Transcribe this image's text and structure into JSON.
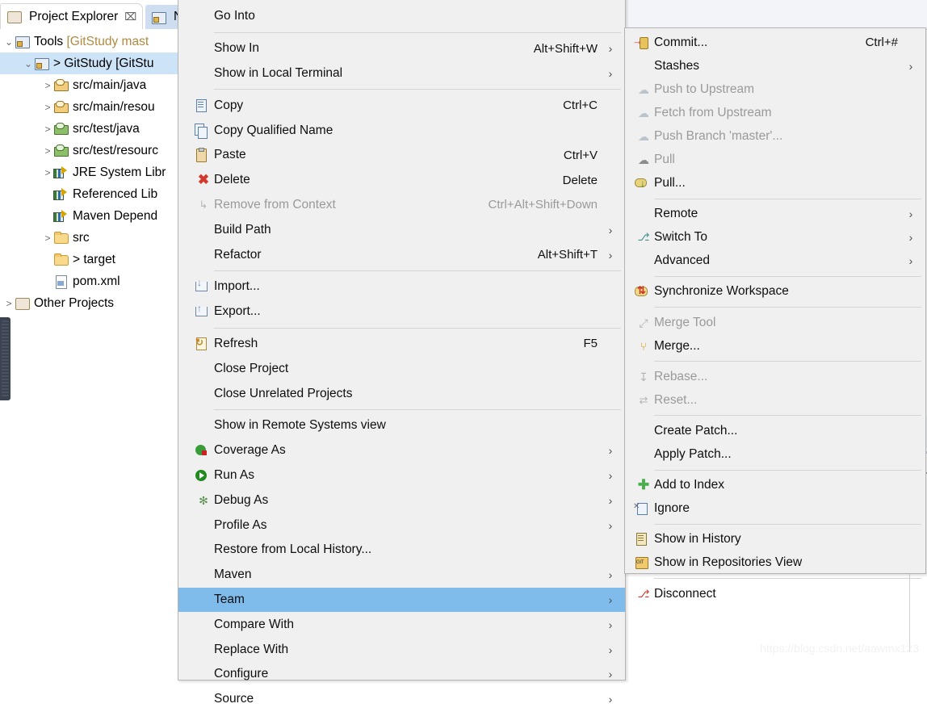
{
  "app": {
    "watermark": "https://blog.csdn.net/aawmx123"
  },
  "left_view": {
    "tabs": [
      {
        "label": "Project Explorer",
        "icon": "project-explorer-icon",
        "close": "⌧",
        "active": true
      },
      {
        "label": "Na",
        "icon": "navigator-icon",
        "active": false
      }
    ],
    "tree": [
      {
        "indent": 0,
        "twisty": "⌄",
        "icon": "project-icon",
        "label": "Tools ",
        "suffix": "[GitStudy mast",
        "selected": false
      },
      {
        "indent": 1,
        "twisty": "⌄",
        "icon": "maven-project-icon",
        "label": "> GitStudy [GitStu",
        "suffix": "",
        "selected": true
      },
      {
        "indent": 2,
        "twisty": ">",
        "icon": "source-package-icon",
        "label": "src/main/java",
        "suffix": "",
        "selected": false
      },
      {
        "indent": 2,
        "twisty": ">",
        "icon": "source-package-icon",
        "label": "src/main/resou",
        "suffix": "",
        "selected": false
      },
      {
        "indent": 2,
        "twisty": ">",
        "icon": "test-package-icon",
        "label": "src/test/java",
        "suffix": "",
        "selected": false
      },
      {
        "indent": 2,
        "twisty": ">",
        "icon": "test-package-icon",
        "label": "src/test/resourc",
        "suffix": "",
        "selected": false
      },
      {
        "indent": 2,
        "twisty": ">",
        "icon": "library-icon",
        "label": "JRE System Libr",
        "suffix": "",
        "selected": false
      },
      {
        "indent": 2,
        "twisty": "",
        "icon": "library-icon",
        "label": "Referenced Lib",
        "suffix": "",
        "selected": false
      },
      {
        "indent": 2,
        "twisty": "",
        "icon": "library-icon",
        "label": "Maven Depend",
        "suffix": "",
        "selected": false
      },
      {
        "indent": 2,
        "twisty": ">",
        "icon": "folder-icon",
        "label": "src",
        "suffix": "",
        "selected": false
      },
      {
        "indent": 2,
        "twisty": "",
        "icon": "folder-icon",
        "label": "> target",
        "suffix": "",
        "selected": false
      },
      {
        "indent": 2,
        "twisty": "",
        "icon": "xml-file-icon",
        "label": "pom.xml",
        "suffix": "",
        "selected": false
      },
      {
        "indent": 0,
        "twisty": ">",
        "icon": "other-projects-icon",
        "label": "Other Projects",
        "suffix": "",
        "selected": false
      }
    ]
  },
  "context_menu": {
    "name": "project-context-menu",
    "items": [
      {
        "type": "item",
        "icon": "",
        "label": "Go Into",
        "accel": "",
        "arrow": false,
        "disabled": false
      },
      {
        "type": "sep"
      },
      {
        "type": "item",
        "icon": "",
        "label": "Show In",
        "accel": "Alt+Shift+W",
        "arrow": true,
        "disabled": false
      },
      {
        "type": "item",
        "icon": "",
        "label": "Show in Local Terminal",
        "accel": "",
        "arrow": true,
        "disabled": false
      },
      {
        "type": "sep"
      },
      {
        "type": "item",
        "icon": "copy-icon",
        "label": "Copy",
        "accel": "Ctrl+C",
        "arrow": false,
        "disabled": false
      },
      {
        "type": "item",
        "icon": "copy-qualified-name-icon",
        "label": "Copy Qualified Name",
        "accel": "",
        "arrow": false,
        "disabled": false
      },
      {
        "type": "item",
        "icon": "paste-icon",
        "label": "Paste",
        "accel": "Ctrl+V",
        "arrow": false,
        "disabled": false
      },
      {
        "type": "item",
        "icon": "delete-icon",
        "label": "Delete",
        "accel": "Delete",
        "arrow": false,
        "disabled": false
      },
      {
        "type": "item",
        "icon": "remove-from-context-icon",
        "label": "Remove from Context",
        "accel": "Ctrl+Alt+Shift+Down",
        "arrow": false,
        "disabled": true
      },
      {
        "type": "item",
        "icon": "",
        "label": "Build Path",
        "accel": "",
        "arrow": true,
        "disabled": false
      },
      {
        "type": "item",
        "icon": "",
        "label": "Refactor",
        "accel": "Alt+Shift+T",
        "arrow": true,
        "disabled": false
      },
      {
        "type": "sep"
      },
      {
        "type": "item",
        "icon": "import-icon",
        "label": "Import...",
        "accel": "",
        "arrow": false,
        "disabled": false
      },
      {
        "type": "item",
        "icon": "export-icon",
        "label": "Export...",
        "accel": "",
        "arrow": false,
        "disabled": false
      },
      {
        "type": "sep"
      },
      {
        "type": "item",
        "icon": "refresh-icon",
        "label": "Refresh",
        "accel": "F5",
        "arrow": false,
        "disabled": false
      },
      {
        "type": "item",
        "icon": "",
        "label": "Close Project",
        "accel": "",
        "arrow": false,
        "disabled": false
      },
      {
        "type": "item",
        "icon": "",
        "label": "Close Unrelated Projects",
        "accel": "",
        "arrow": false,
        "disabled": false
      },
      {
        "type": "sep"
      },
      {
        "type": "item",
        "icon": "",
        "label": "Show in Remote Systems view",
        "accel": "",
        "arrow": false,
        "disabled": false
      },
      {
        "type": "item",
        "icon": "coverage-icon",
        "label": "Coverage As",
        "accel": "",
        "arrow": true,
        "disabled": false
      },
      {
        "type": "item",
        "icon": "run-icon",
        "label": "Run As",
        "accel": "",
        "arrow": true,
        "disabled": false
      },
      {
        "type": "item",
        "icon": "debug-icon",
        "label": "Debug As",
        "accel": "",
        "arrow": true,
        "disabled": false
      },
      {
        "type": "item",
        "icon": "",
        "label": "Profile As",
        "accel": "",
        "arrow": true,
        "disabled": false
      },
      {
        "type": "item",
        "icon": "",
        "label": "Restore from Local History...",
        "accel": "",
        "arrow": false,
        "disabled": false
      },
      {
        "type": "item",
        "icon": "",
        "label": "Maven",
        "accel": "",
        "arrow": true,
        "disabled": false
      },
      {
        "type": "item",
        "icon": "",
        "label": "Team",
        "accel": "",
        "arrow": true,
        "disabled": false,
        "selected": true
      },
      {
        "type": "item",
        "icon": "",
        "label": "Compare With",
        "accel": "",
        "arrow": true,
        "disabled": false
      },
      {
        "type": "item",
        "icon": "",
        "label": "Replace With",
        "accel": "",
        "arrow": true,
        "disabled": false
      },
      {
        "type": "item",
        "icon": "",
        "label": "Configure",
        "accel": "",
        "arrow": true,
        "disabled": false
      },
      {
        "type": "item",
        "icon": "",
        "label": "Source",
        "accel": "",
        "arrow": true,
        "disabled": false
      }
    ]
  },
  "team_submenu": {
    "name": "team-submenu",
    "items": [
      {
        "type": "item",
        "icon": "commit-icon",
        "label": "Commit...",
        "accel": "Ctrl+#",
        "arrow": false,
        "disabled": false
      },
      {
        "type": "item",
        "icon": "",
        "label": "Stashes",
        "accel": "",
        "arrow": true,
        "disabled": false
      },
      {
        "type": "item",
        "icon": "push-upstream-icon",
        "label": "Push to Upstream",
        "accel": "",
        "arrow": false,
        "disabled": true
      },
      {
        "type": "item",
        "icon": "fetch-upstream-icon",
        "label": "Fetch from Upstream",
        "accel": "",
        "arrow": false,
        "disabled": true
      },
      {
        "type": "item",
        "icon": "push-branch-icon",
        "label": "Push Branch 'master'...",
        "accel": "",
        "arrow": false,
        "disabled": true
      },
      {
        "type": "item",
        "icon": "pull-icon",
        "label": "Pull",
        "accel": "",
        "arrow": false,
        "disabled": true
      },
      {
        "type": "item",
        "icon": "pull-dialog-icon",
        "label": "Pull...",
        "accel": "",
        "arrow": false,
        "disabled": false
      },
      {
        "type": "sep"
      },
      {
        "type": "item",
        "icon": "",
        "label": "Remote",
        "accel": "",
        "arrow": true,
        "disabled": false
      },
      {
        "type": "item",
        "icon": "switch-to-icon",
        "label": "Switch To",
        "accel": "",
        "arrow": true,
        "disabled": false
      },
      {
        "type": "item",
        "icon": "",
        "label": "Advanced",
        "accel": "",
        "arrow": true,
        "disabled": false
      },
      {
        "type": "sep"
      },
      {
        "type": "item",
        "icon": "synchronize-icon",
        "label": "Synchronize Workspace",
        "accel": "",
        "arrow": false,
        "disabled": false
      },
      {
        "type": "sep"
      },
      {
        "type": "item",
        "icon": "merge-tool-icon",
        "label": "Merge Tool",
        "accel": "",
        "arrow": false,
        "disabled": true
      },
      {
        "type": "item",
        "icon": "merge-icon",
        "label": "Merge...",
        "accel": "",
        "arrow": false,
        "disabled": false
      },
      {
        "type": "sep"
      },
      {
        "type": "item",
        "icon": "rebase-icon",
        "label": "Rebase...",
        "accel": "",
        "arrow": false,
        "disabled": true
      },
      {
        "type": "item",
        "icon": "reset-icon",
        "label": "Reset...",
        "accel": "",
        "arrow": false,
        "disabled": true
      },
      {
        "type": "sep"
      },
      {
        "type": "item",
        "icon": "",
        "label": "Create Patch...",
        "accel": "",
        "arrow": false,
        "disabled": false
      },
      {
        "type": "item",
        "icon": "",
        "label": "Apply Patch...",
        "accel": "",
        "arrow": false,
        "disabled": false
      },
      {
        "type": "sep"
      },
      {
        "type": "item",
        "icon": "add-to-index-icon",
        "label": "Add to Index",
        "accel": "",
        "arrow": false,
        "disabled": false
      },
      {
        "type": "item",
        "icon": "ignore-icon",
        "label": "Ignore",
        "accel": "",
        "arrow": false,
        "disabled": false
      },
      {
        "type": "sep"
      },
      {
        "type": "item",
        "icon": "show-in-history-icon",
        "label": "Show in History",
        "accel": "",
        "arrow": false,
        "disabled": false
      },
      {
        "type": "item",
        "icon": "show-in-repositories-icon",
        "label": "Show in Repositories View",
        "accel": "",
        "arrow": false,
        "disabled": false
      },
      {
        "type": "sep"
      },
      {
        "type": "item",
        "icon": "disconnect-icon",
        "label": "Disconnect",
        "accel": "",
        "arrow": false,
        "disabled": false
      }
    ]
  },
  "colors": {
    "menu_bg": "#f0f0f0",
    "menu_border": "#b4b4b4",
    "selection": "#7fbceb",
    "tree_selection": "#cde3f7",
    "editor_band": "#f3f4f9",
    "disabled_text": "#9a9a9a"
  }
}
